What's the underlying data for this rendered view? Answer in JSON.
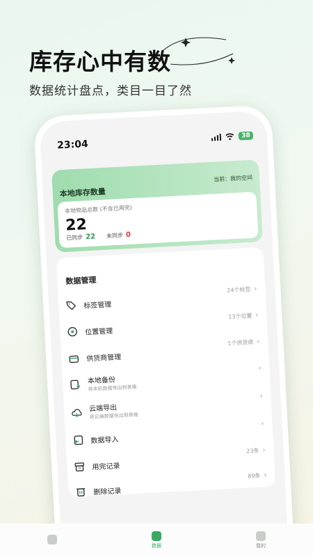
{
  "hero": {
    "title": "库存心中有数",
    "subtitle": "数据统计盘点，类目一目了然"
  },
  "status_bar": {
    "time": "23:04",
    "battery": "38"
  },
  "inventory": {
    "title": "本地库存数量",
    "space_label": "当前：我的空间",
    "total_label": "本地物品总数 (不含已用完)",
    "total_count": "22",
    "synced_label": "已同步",
    "synced_count": "22",
    "unsynced_label": "未同步",
    "unsynced_count": "0"
  },
  "data_management": {
    "title": "数据管理",
    "items": [
      {
        "label": "标签管理",
        "sub": "",
        "value": "24个标签",
        "icon": "tag-icon"
      },
      {
        "label": "位置管理",
        "sub": "",
        "value": "13个位置",
        "icon": "location-icon"
      },
      {
        "label": "供货商管理",
        "sub": "",
        "value": "1个供货商",
        "icon": "store-icon"
      },
      {
        "label": "本地备份",
        "sub": "将本机数据导出到表格",
        "value": "",
        "icon": "backup-icon"
      },
      {
        "label": "云端导出",
        "sub": "将云端数据导出到表格",
        "value": "",
        "icon": "cloud-icon"
      },
      {
        "label": "数据导入",
        "sub": "",
        "value": "",
        "icon": "import-icon"
      },
      {
        "label": "用完记录",
        "sub": "",
        "value": "23条",
        "icon": "box-icon"
      },
      {
        "label": "删除记录",
        "sub": "",
        "value": "89条",
        "icon": "trash-icon"
      }
    ]
  },
  "tab_bar": {
    "tabs": [
      {
        "label": "",
        "icon": "home-icon"
      },
      {
        "label": "数据",
        "icon": "chart-icon"
      },
      {
        "label": "我的",
        "icon": "profile-icon"
      }
    ]
  },
  "colors": {
    "accent": "#3aa966",
    "dark_green": "#2f8a5c",
    "danger": "#e03c3c"
  }
}
